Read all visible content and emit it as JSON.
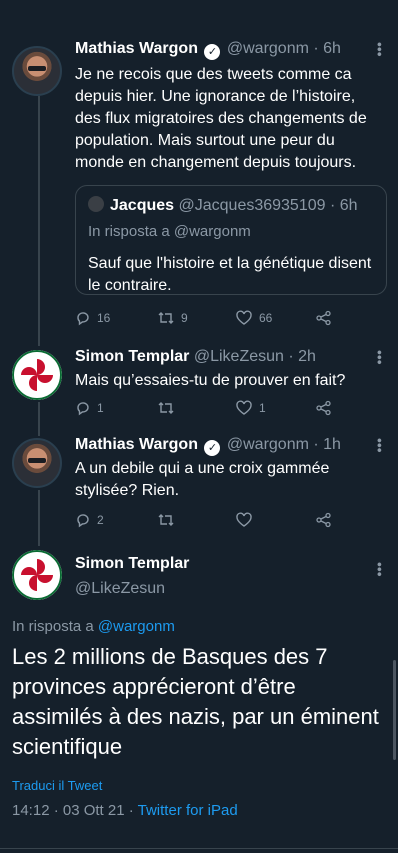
{
  "tweets": [
    {
      "name": "Mathias Wargon",
      "handle": "@wargonm",
      "time": "· 6h",
      "text": "Je ne recois que des tweets comme ca depuis hier. Une ignorance de l’histoire, des flux migratoires des changements de population. Mais surtout une peur du monde en changement depuis toujours.",
      "quote": {
        "name": "Jacques",
        "handle": "@Jacques36935109 · 6h",
        "reply": "In risposta a @wargonm",
        "text": "Sauf que l'histoire et la génétique disent le contraire."
      },
      "replies": "16",
      "retweets": "9",
      "likes": "66"
    },
    {
      "name": "Simon Templar",
      "handle": "@LikeZesun",
      "time": "· 2h",
      "text": "Mais qu’essaies-tu de prouver en fait?",
      "replies": "1",
      "retweets": "",
      "likes": "1"
    },
    {
      "name": "Mathias Wargon",
      "handle": "@wargonm",
      "time": "· 1h",
      "text": "A un debile qui a une croix gammée stylisée? Rien.",
      "replies": "2",
      "retweets": "",
      "likes": ""
    }
  ],
  "focused": {
    "name": "Simon Templar",
    "handle": "@LikeZesun",
    "reply_prefix": "In risposta a ",
    "reply_handle": "@wargonm",
    "text": "Les 2 millions de Basques des 7 provinces apprécieront d’être assimilés à des nazis, par un éminent scientifique",
    "translate": "Traduci il Tweet",
    "timestamp": "14:12 · 03 Ott 21 · ",
    "source": "Twitter for iPad"
  },
  "colors": {
    "background": "#15202b",
    "accent": "#1d9bf0",
    "muted": "#8b98a5",
    "lauburu": "#c8102e"
  },
  "icons": {
    "reply": "reply-icon",
    "retweet": "retweet-icon",
    "like": "heart-icon",
    "share": "share-icon",
    "more": "more-icon",
    "verified": "verified-icon"
  }
}
